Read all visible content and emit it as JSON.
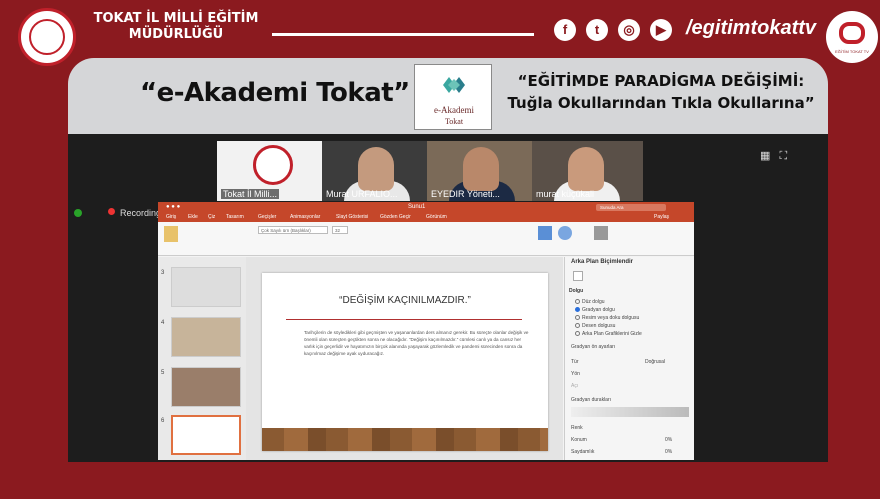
{
  "header": {
    "org_title": "TOKAT İL MİLLİ EĞİTİM MÜDÜRLÜĞÜ",
    "social_icons": [
      "facebook-icon",
      "twitter-icon",
      "instagram-icon",
      "youtube-icon"
    ],
    "handle": "/egitimtokattv",
    "tv_logo_caption": "EĞİTİM TOKAT TV"
  },
  "banner": {
    "program": "“e-Akademi Tokat”",
    "logo_line1": "e-Akademi",
    "logo_line2": "Tokat",
    "topic_line1": "“EĞİTİMDE PARADİGMA DEĞİŞİMİ:",
    "topic_line2": "Tuğla Okullarından Tıkla Okullarına”"
  },
  "zoom": {
    "participants": [
      {
        "name": "Tokat İl Milli..."
      },
      {
        "name": "Murat URFALIO..."
      },
      {
        "name": "EYEDIR Yöneti..."
      },
      {
        "name": "murat küçükali"
      }
    ],
    "recording_label": "Recording"
  },
  "ppt": {
    "file_name": "Sunu1",
    "search_placeholder": "Sunuda Ara",
    "tabs": [
      "Giriş",
      "Ekle",
      "Çiz",
      "Tasarım",
      "Geçişler",
      "Animasyonlar",
      "Slayt Gösterisi",
      "Gözden Geçir",
      "Görünüm"
    ],
    "share_label": "Paylaş",
    "font_name": "Çok Sayılı ürn (Başlıklar)",
    "font_size": "32",
    "thumb_numbers": [
      "3",
      "4",
      "5",
      "6"
    ],
    "slide_title": "“DEĞİŞİM KAÇINILMAZDIR.”",
    "slide_body": "Tarihçilerin de söyledikleri gibi geçmişten ve yaşananlardan ders almanız gerekir. Bu süreçte olanlar değişik ve önemli olan süreçten geçtikten sonra ne olacağıdır. “Değişim kaçınılmazdır.” cümlesi canlı ya da cansız her varlık için geçerlidir ve hayatımızın birçok alanında yaşayarak gözlemledik ve pandemi sürecinden sonra da kaçınılmaz değişime ayak uyduracağız.",
    "pane": {
      "title": "Arka Plan Biçimlendir",
      "section": "Dolgu",
      "options": [
        "Düz dolgu",
        "Gradyan dolgu",
        "Resim veya doku dolgusu",
        "Desen dolgusu",
        "Arka Plan Grafiklerini Gizle"
      ],
      "selected_index": 1,
      "preset_label": "Gradyan ön ayarları",
      "type_label": "Tür",
      "type_value": "Doğrusal",
      "direction_label": "Yön",
      "angle_label": "Açı",
      "stops_label": "Gradyan durakları",
      "color_label": "Renk",
      "position_label": "Konum",
      "position_value": "0%",
      "transparency_label": "Saydamlık",
      "transparency_value": "0%"
    }
  }
}
